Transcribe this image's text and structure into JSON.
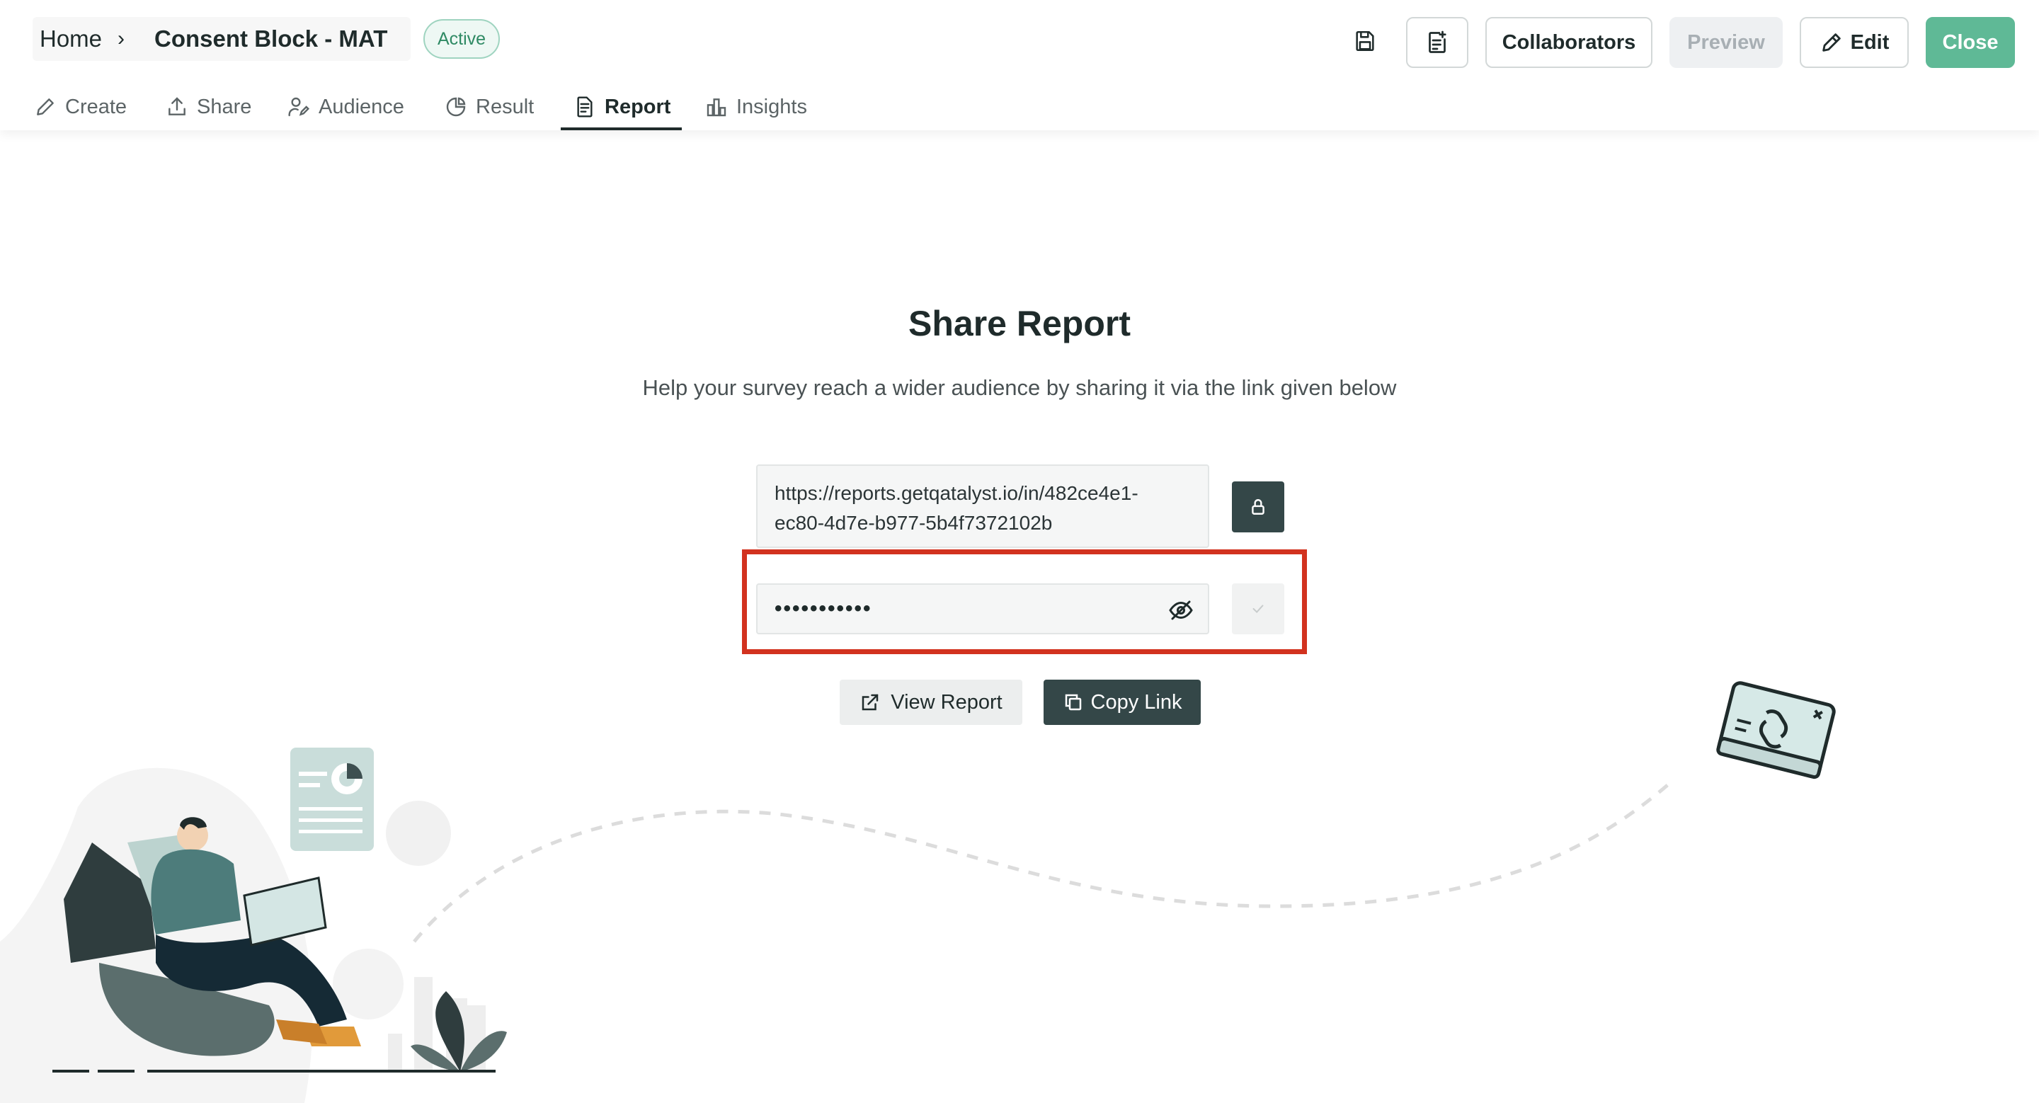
{
  "header": {
    "breadcrumb_home": "Home",
    "breadcrumb_separator": "›",
    "survey_title": "Consent Block - MAT",
    "status_badge": "Active",
    "buttons": {
      "collaborators": "Collaborators",
      "preview": "Preview",
      "edit": "Edit",
      "close": "Close"
    }
  },
  "tabs": [
    {
      "label": "Create",
      "icon": "pencil-icon",
      "active": false
    },
    {
      "label": "Share",
      "icon": "upload-icon",
      "active": false
    },
    {
      "label": "Audience",
      "icon": "user-edit-icon",
      "active": false
    },
    {
      "label": "Result",
      "icon": "pie-chart-icon",
      "active": false
    },
    {
      "label": "Report",
      "icon": "document-icon",
      "active": true
    },
    {
      "label": "Insights",
      "icon": "bar-chart-icon",
      "active": false
    }
  ],
  "main": {
    "heading": "Share Report",
    "subheading": "Help your survey reach a wider audience by sharing it via the link given below",
    "report_link_line1": "https://reports.getqatalyst.io/in/482ce4e1-",
    "report_link_line2": "ec80-4d7e-b977-5b4f7372102b",
    "password_masked": "•••••••••••",
    "view_report": "View Report",
    "copy_link": "Copy Link"
  },
  "colors": {
    "accent_green": "#5fb996",
    "dark_slate": "#344748",
    "highlight_red": "#d2321f",
    "badge_text": "#2f8a64"
  }
}
